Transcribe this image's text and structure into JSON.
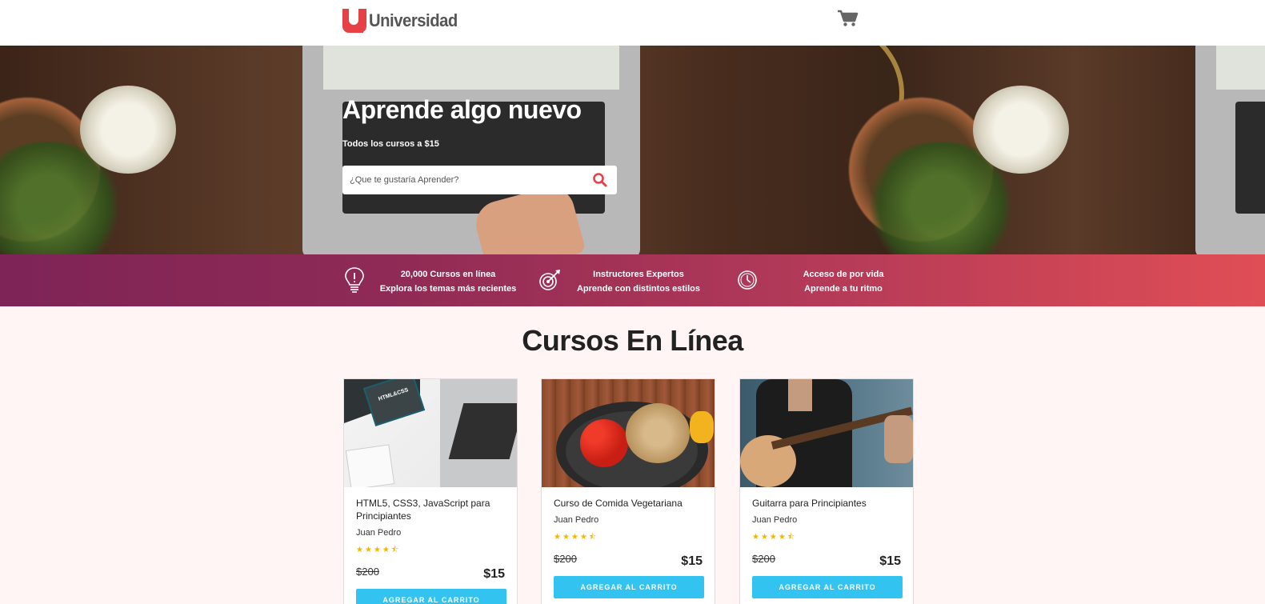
{
  "header": {
    "brand": "Universidad",
    "cart_icon": "shopping-cart-icon"
  },
  "hero": {
    "title": "Aprende algo nuevo",
    "subtitle": "Todos los cursos a $15",
    "search": {
      "placeholder": "¿Que te gustaría Aprender?",
      "value": "",
      "icon": "search-icon"
    }
  },
  "features": [
    {
      "icon": "lightbulb-icon",
      "line1": "20,000 Cursos en línea",
      "line2": "Explora los temas más recientes"
    },
    {
      "icon": "target-icon",
      "line1": "Instructores Expertos",
      "line2": "Aprende con distintos estilos"
    },
    {
      "icon": "clock-icon",
      "line1": "Acceso de por vida",
      "line2": "Aprende a tu ritmo"
    }
  ],
  "courses": {
    "title": "Cursos En Línea",
    "items": [
      {
        "title": "HTML5, CSS3, JavaScript para Principiantes",
        "author": "Juan Pedro",
        "rating": 4.5,
        "stars": "★★★★⯪",
        "old_price": "$200",
        "price": "$15",
        "button": "AGREGAR AL CARRITO",
        "image_label": "HTML&CSS"
      },
      {
        "title": "Curso de Comida Vegetariana",
        "author": "Juan Pedro",
        "rating": 4.5,
        "stars": "★★★★⯪",
        "old_price": "$200",
        "price": "$15",
        "button": "AGREGAR AL CARRITO"
      },
      {
        "title": "Guitarra para Principiantes",
        "author": "Juan Pedro",
        "rating": 4.5,
        "stars": "★★★★⯪",
        "old_price": "$200",
        "price": "$15",
        "button": "AGREGAR AL CARRITO"
      }
    ]
  },
  "colors": {
    "accent": "#e64147",
    "button": "#33c3f0",
    "stars": "#f4b400",
    "band_start": "#7e2457",
    "band_end": "#e04e55"
  }
}
